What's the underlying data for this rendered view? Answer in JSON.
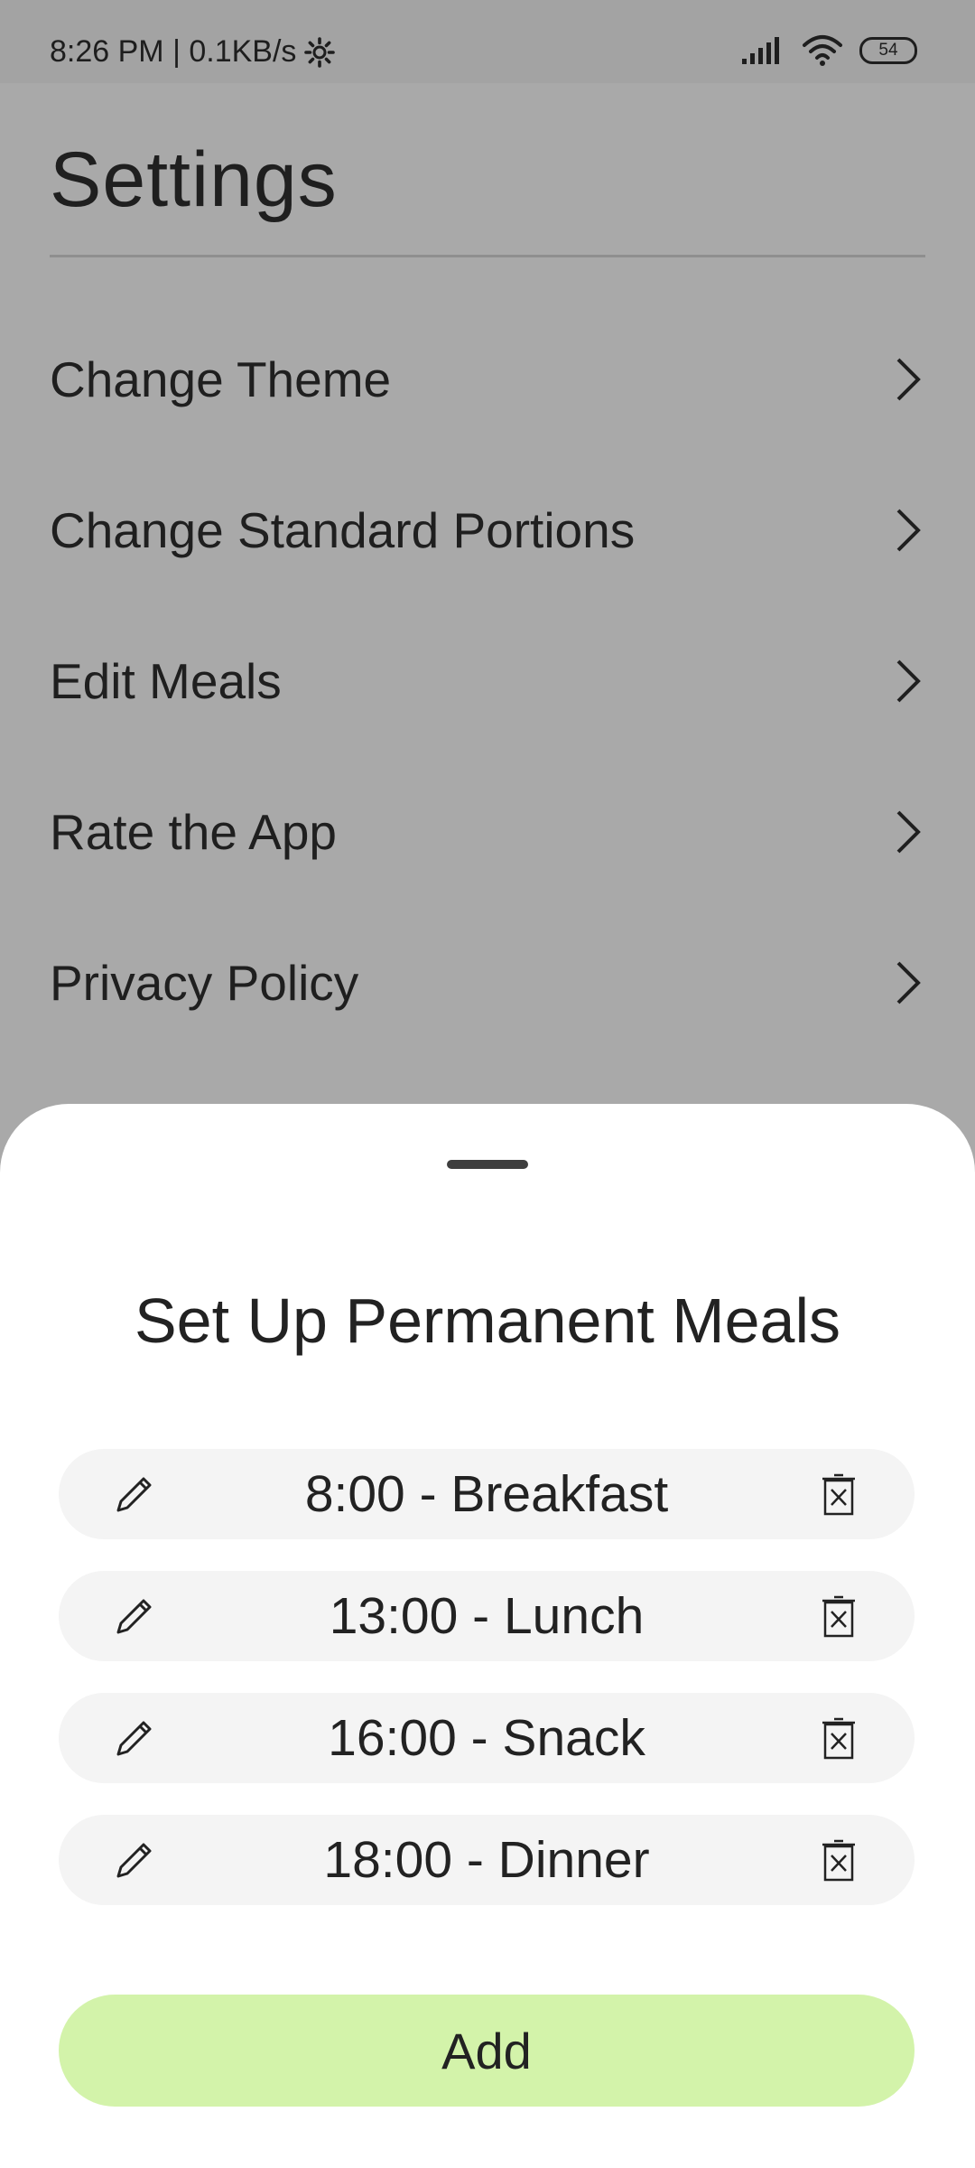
{
  "status_bar": {
    "time_speed": "8:26 PM | 0.1KB/s",
    "battery": "54",
    "icons": [
      "gear-icon",
      "signal-icon",
      "wifi-icon",
      "battery-icon"
    ]
  },
  "settings": {
    "title": "Settings",
    "items": [
      {
        "label": "Change Theme"
      },
      {
        "label": "Change Standard Portions"
      },
      {
        "label": "Edit Meals"
      },
      {
        "label": "Rate the App"
      },
      {
        "label": "Privacy Policy"
      }
    ]
  },
  "sheet": {
    "title": "Set Up Permanent Meals",
    "meals": [
      {
        "label": "8:00 - Breakfast"
      },
      {
        "label": "13:00 - Lunch"
      },
      {
        "label": "16:00 - Snack"
      },
      {
        "label": "18:00 - Dinner"
      }
    ],
    "add_label": "Add"
  },
  "colors": {
    "scrim": "#a9a9a9",
    "sheet_bg": "#ffffff",
    "row_bg": "#f4f4f4",
    "add_button": "#d3f3aa"
  }
}
